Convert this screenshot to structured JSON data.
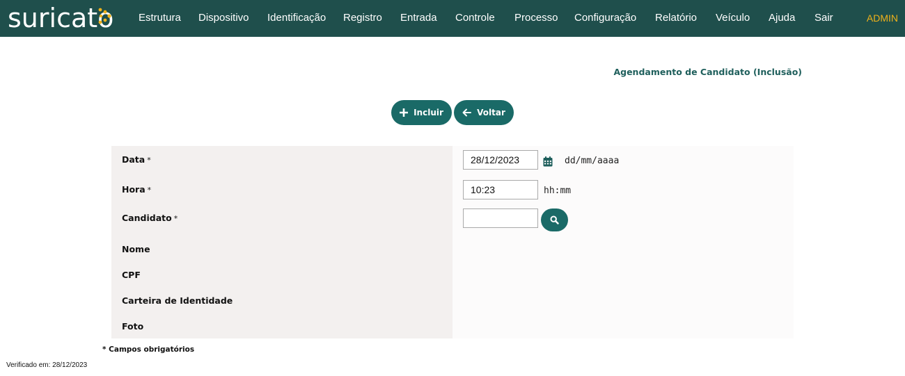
{
  "brand": {
    "logo_text": "suricato",
    "accent_color": "#f0b21a",
    "header_bg": "#1f4f4c"
  },
  "nav": {
    "items": [
      {
        "label": "Estrutura"
      },
      {
        "label": "Dispositivo"
      },
      {
        "label": "Identificação"
      },
      {
        "label": "Registro"
      },
      {
        "label": "Entrada"
      },
      {
        "label": "Controle"
      },
      {
        "label": "Processo"
      },
      {
        "label": "Configuração"
      },
      {
        "label": "Relatório"
      },
      {
        "label": "Veículo"
      },
      {
        "label": "Ajuda"
      },
      {
        "label": "Sair"
      }
    ],
    "user": "ADMIN"
  },
  "page": {
    "title": "Agendamento de Candidato (Inclusão)"
  },
  "toolbar": {
    "incluir_label": "Incluir",
    "voltar_label": "Voltar",
    "button_color": "#1a6a67"
  },
  "form": {
    "required_mark": "*",
    "data": {
      "label": "Data",
      "value": "28/12/2023",
      "hint": "dd/mm/aaaa"
    },
    "hora": {
      "label": "Hora",
      "value": "10:23",
      "hint": "hh:mm"
    },
    "candidato": {
      "label": "Candidato",
      "value": ""
    },
    "nome": {
      "label": "Nome"
    },
    "cpf": {
      "label": "CPF"
    },
    "carteira": {
      "label": "Carteira de Identidade"
    },
    "foto": {
      "label": "Foto"
    }
  },
  "footer": {
    "required_note": "* Campos obrigatórios",
    "verified": "Verificado em: 28/12/2023"
  },
  "icons": {
    "logo": "dots-logo-icon",
    "incluir": "plus-icon",
    "voltar": "arrow-left-icon",
    "calendar": "calendar-icon",
    "search": "search-icon"
  }
}
